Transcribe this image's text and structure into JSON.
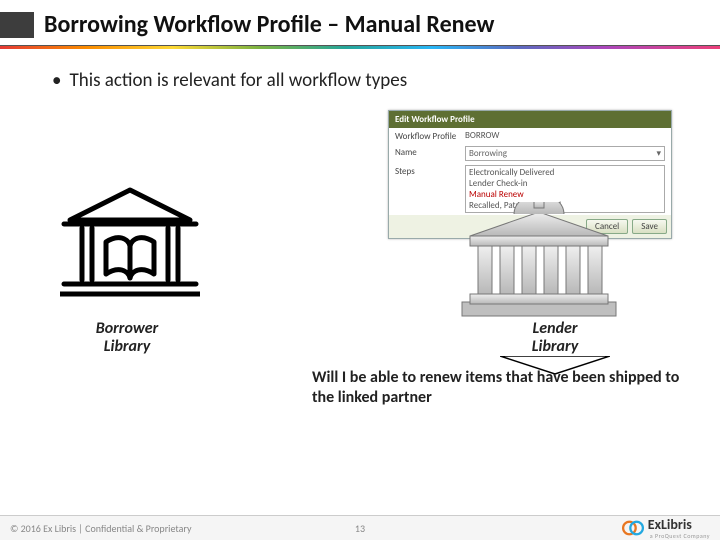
{
  "title": "Borrowing Workflow Profile – Manual Renew",
  "bullet": "This action is relevant for all workflow types",
  "configPanel": {
    "header": "Edit Workflow Profile",
    "labels": {
      "profile": "Workflow Profile",
      "name": "Name",
      "steps": "Steps"
    },
    "profileValue": "BORROW",
    "nameValue": "Borrowing",
    "steps": {
      "s1": "Electronically Delivered",
      "s2": "Lender Check-in",
      "s3": "Manual Renew",
      "s4": "Recalled, Patron Renewal"
    },
    "cancel": "Cancel",
    "save": "Save"
  },
  "captions": {
    "borrowerL1": "Borrower",
    "borrowerL2": "Library",
    "lenderL1": "Lender",
    "lenderL2": "Library"
  },
  "question": "Will I be able to renew items that have been shipped to the linked partner",
  "footer": {
    "copyright": "© 2016 Ex Libris | Confidential & Proprietary",
    "pageNumber": "13",
    "brandName": "ExLibris",
    "brandSub": "a ProQuest Company"
  }
}
